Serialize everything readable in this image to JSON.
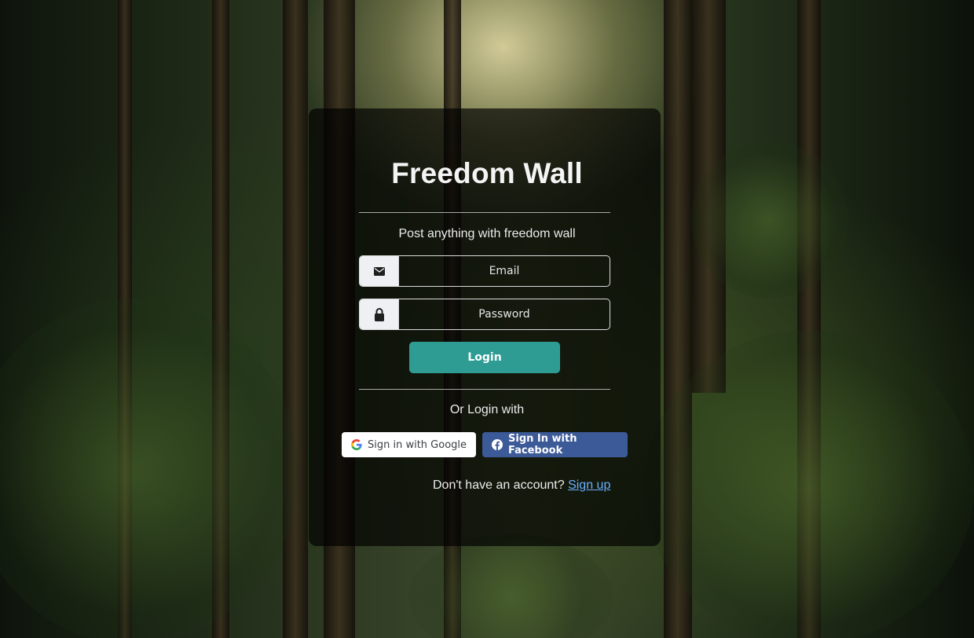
{
  "app": {
    "title": "Freedom Wall",
    "tagline": "Post anything with freedom wall"
  },
  "form": {
    "email_placeholder": "Email",
    "password_placeholder": "Password",
    "login_label": "Login"
  },
  "social": {
    "or_label": "Or Login with",
    "google_label": "Sign in with Google",
    "facebook_label": "Sign In with Facebook"
  },
  "footer": {
    "prompt": "Don't have an account?",
    "signup_link": "Sign up"
  },
  "icons": {
    "email": "envelope-icon",
    "password": "lock-icon",
    "google": "google-logo-icon",
    "facebook": "facebook-logo-icon"
  },
  "colors": {
    "login_button": "#2f9c94",
    "facebook_button": "#3d5a98",
    "link": "#6ab0ff"
  }
}
